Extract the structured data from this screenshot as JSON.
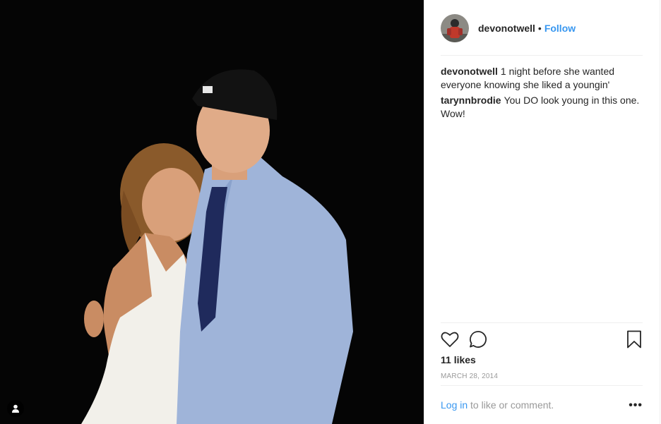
{
  "post": {
    "username": "devonotwell",
    "follow_label": "Follow",
    "separator": "•",
    "comments": [
      {
        "user": "devonotwell",
        "text": "1 night before she wanted everyone knowing she liked a youngin'"
      },
      {
        "user": "tarynnbrodie",
        "text": "You DO look young in this one. Wow!"
      }
    ],
    "likes": "11 likes",
    "date": "MARCH 28, 2014",
    "login_link": "Log in",
    "login_text": "to like or comment.",
    "more_label": "•••"
  },
  "icons": {
    "like": "heart-icon",
    "comment": "comment-bubble-icon",
    "save": "bookmark-icon",
    "tag": "user-tag-icon",
    "more": "more-options-icon"
  },
  "colors": {
    "link": "#3897f0",
    "text": "#262626",
    "muted": "#999999",
    "divider": "#efefef"
  }
}
